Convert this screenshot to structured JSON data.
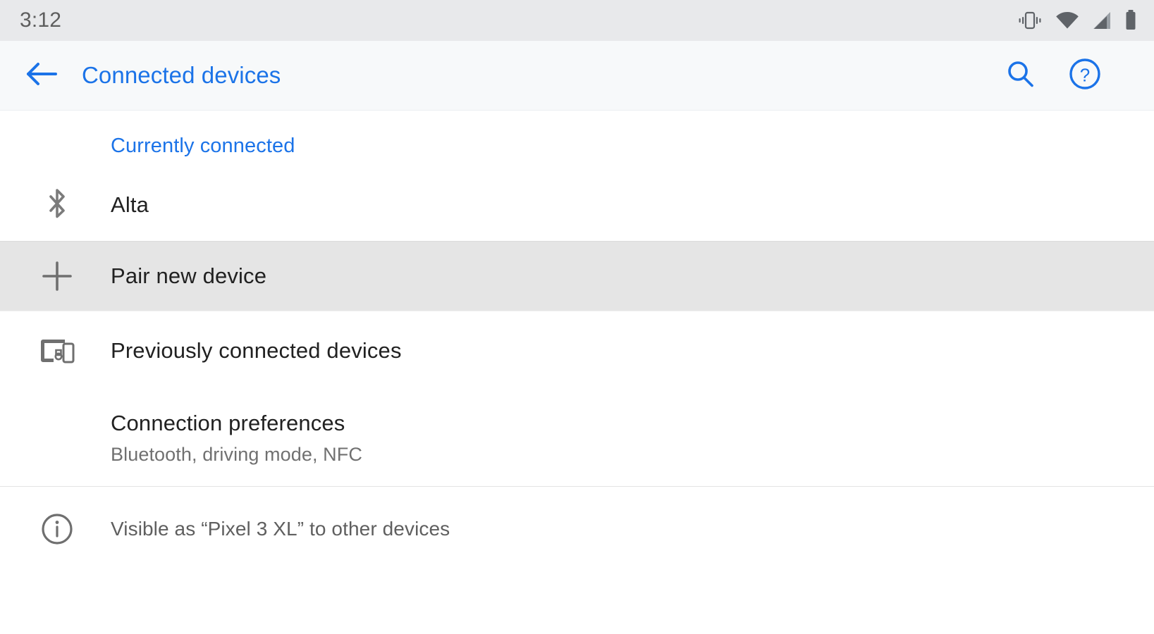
{
  "status_bar": {
    "clock": "3:12",
    "icons": [
      {
        "name": "vibrate-icon",
        "label": "vibrate"
      },
      {
        "name": "wifi-icon",
        "label": "wifi"
      },
      {
        "name": "cell-signal-icon",
        "label": "cellular signal"
      },
      {
        "name": "battery-icon",
        "label": "battery"
      }
    ],
    "background_color": "#e8e9eb",
    "icon_color": "#5f6368"
  },
  "app_bar": {
    "back_icon": "arrow-back-icon",
    "title": "Connected devices",
    "search_icon": "search-icon",
    "help_icon": "help-circle-icon",
    "accent_color": "#1b73e8",
    "background_color": "#f7f9fa"
  },
  "content": {
    "section_header": "Currently connected",
    "rows": [
      {
        "icon": "bluetooth-icon",
        "title": "Alta",
        "subtitle": "",
        "highlighted": false
      },
      {
        "icon": "plus-icon",
        "title": "Pair new device",
        "subtitle": "",
        "highlighted": true
      },
      {
        "icon": "devices-icon",
        "title": "Previously connected devices",
        "subtitle": "",
        "highlighted": false
      },
      {
        "icon": "",
        "title": "Connection preferences",
        "subtitle": "Bluetooth, driving mode, NFC",
        "highlighted": false
      }
    ],
    "footer": {
      "icon": "info-circle-icon",
      "text": "Visible as “Pixel 3 XL” to other devices"
    },
    "highlight_color": "#e5e5e5",
    "title_color": "#212121",
    "subtitle_color": "#707070"
  }
}
